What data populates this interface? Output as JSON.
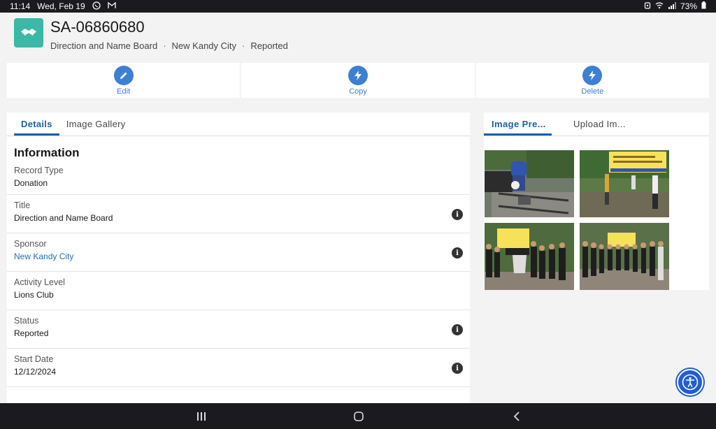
{
  "status_bar": {
    "time": "11:14",
    "date": "Wed, Feb 19",
    "battery": "73%",
    "left_icons": [
      "whatsapp-icon",
      "gmail-icon"
    ],
    "right_icons": [
      "alarm-icon",
      "wifi-icon",
      "signal-icon",
      "battery-icon"
    ]
  },
  "record": {
    "icon": "handshake-icon",
    "title": "SA-06860680",
    "subtitle": [
      "Direction and Name Board",
      "New Kandy City",
      "Reported"
    ],
    "separator": "·"
  },
  "actions": [
    {
      "label": "Edit",
      "icon": "pencil-icon"
    },
    {
      "label": "Copy",
      "icon": "lightning-icon"
    },
    {
      "label": "Delete",
      "icon": "lightning-icon"
    }
  ],
  "left_tabs": [
    {
      "label": "Details",
      "active": true
    },
    {
      "label": "Image Gallery",
      "active": false
    }
  ],
  "section_title": "Information",
  "fields": [
    {
      "label": "Record Type",
      "value": "Donation",
      "info": false,
      "link": false
    },
    {
      "label": "Title",
      "value": "Direction and Name Board",
      "info": true,
      "link": false
    },
    {
      "label": "Sponsor",
      "value": "New Kandy City",
      "info": true,
      "link": true
    },
    {
      "label": "Activity Level",
      "value": "Lions Club",
      "info": false,
      "link": false
    },
    {
      "label": "Status",
      "value": "Reported",
      "info": true,
      "link": false
    },
    {
      "label": "Start Date",
      "value": "12/12/2024",
      "info": true,
      "link": false
    }
  ],
  "right_tabs": [
    {
      "label": "Image Pre...",
      "active": true
    },
    {
      "label": "Upload Im...",
      "active": false
    }
  ],
  "gallery": [
    {
      "description": "welding metal frame"
    },
    {
      "description": "group with yellow banner"
    },
    {
      "description": "group photo with banner"
    },
    {
      "description": "group standing in line"
    }
  ],
  "colors": {
    "accent": "#1b5fa8",
    "action_blue": "#3d7fd1",
    "object_icon": "#3bb8a6",
    "link": "#1b6fb5",
    "accessibility_button": "#1f5fd0"
  }
}
